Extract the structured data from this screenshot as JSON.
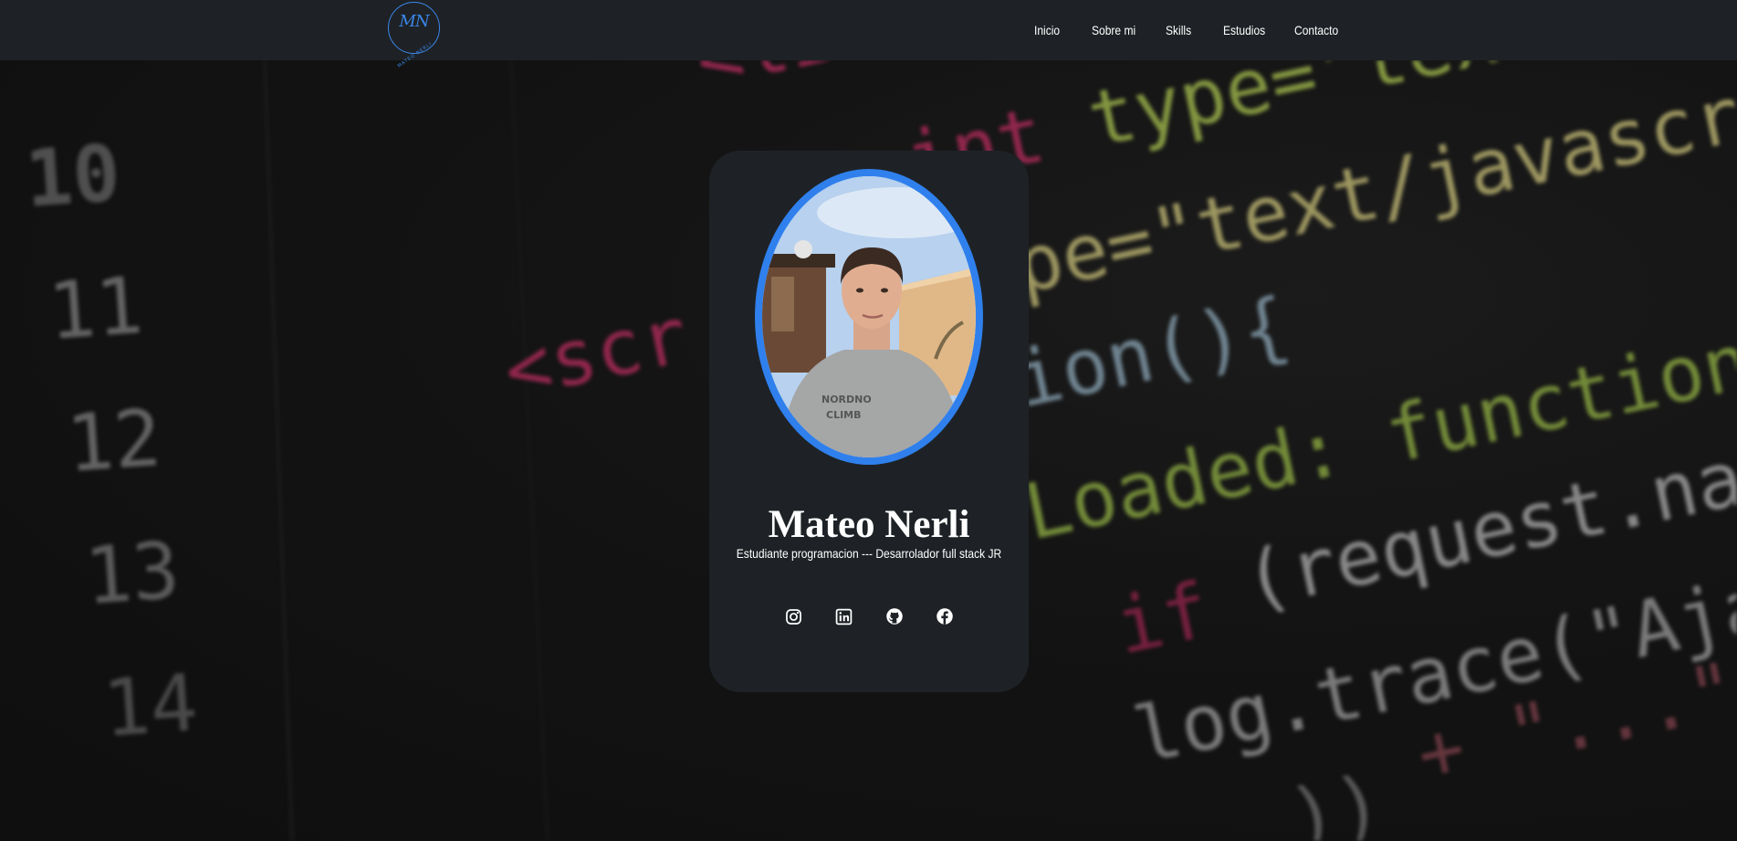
{
  "header": {
    "logo": {
      "mark": "MN",
      "sub": "MATEO NERLI"
    },
    "nav": [
      {
        "label": "Inicio"
      },
      {
        "label": "Sobre mi"
      },
      {
        "label": "Skills"
      },
      {
        "label": "Estudios"
      },
      {
        "label": "Contacto"
      }
    ]
  },
  "background": {
    "line_numbers": [
      "10",
      "11",
      "12",
      "13",
      "14"
    ],
    "code_lines": [
      "<link",
      "type=\"text/ja",
      "int",
      "pe=\"text/javascrip",
      "<scr",
      "ion(){",
      "Loaded:  function(",
      "(request.nam",
      "if",
      "log.trace(\"Ajax",
      "+  \"...\")",
      "))"
    ]
  },
  "profile": {
    "name": "Mateo Nerli",
    "role": "Estudiante programacion --- Desarrolador full stack JR",
    "accent": "#2f80ed",
    "socials": [
      {
        "icon": "instagram-icon"
      },
      {
        "icon": "linkedin-icon"
      },
      {
        "icon": "github-icon"
      },
      {
        "icon": "facebook-icon"
      }
    ]
  }
}
